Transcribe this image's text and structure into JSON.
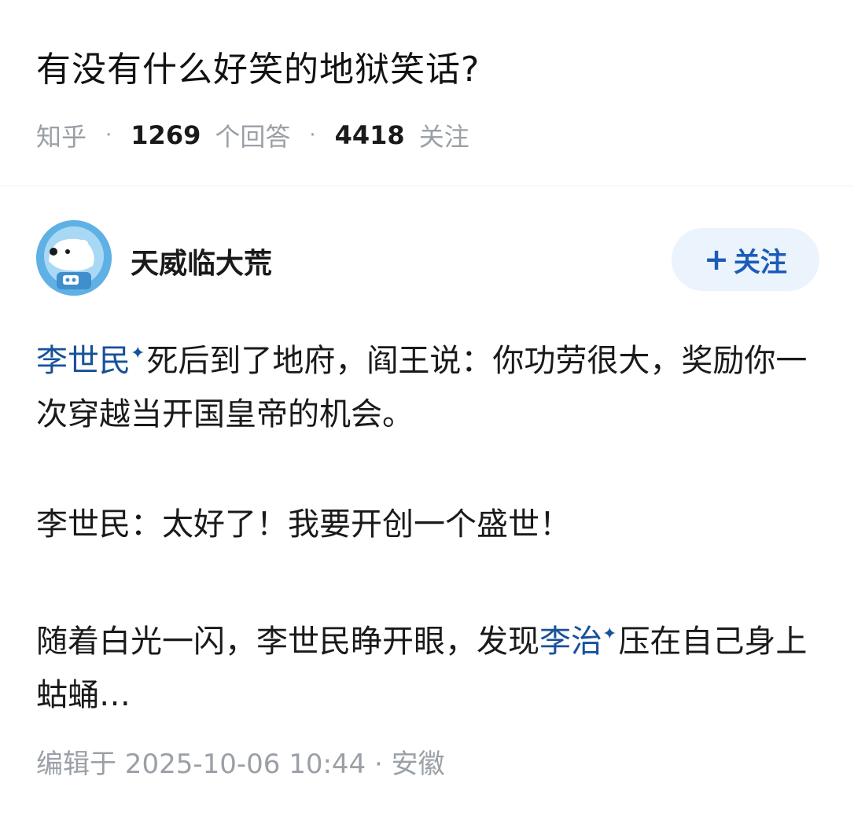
{
  "question": {
    "title": "有没有什么好笑的地狱笑话?",
    "source": "知乎",
    "answer_count": "1269",
    "answer_suffix": "个回答",
    "follower_count": "4418",
    "follower_suffix": "关注"
  },
  "author": {
    "name": "天威临大荒",
    "avatar_icon": "polar-bear-astronaut-icon",
    "follow_label": "关注"
  },
  "answer": {
    "p1_link": "李世民",
    "p1_text_a": "死后到了地府，阎王说：你功劳很大，奖励你一次穿越当开国皇帝的机会。",
    "p2": "李世民：太好了！我要开创一个盛世！",
    "p3_a": "随着白光一闪，李世民睁开眼，发现",
    "p3_link": "李治",
    "p3_b": "压在自己身上蛄蛹…"
  },
  "edit_info": "编辑于 2025-10-06 10:44 · 安徽",
  "colors": {
    "link": "#175199",
    "follow_bg": "#ebf3fd",
    "follow_text": "#1c5cb8"
  }
}
